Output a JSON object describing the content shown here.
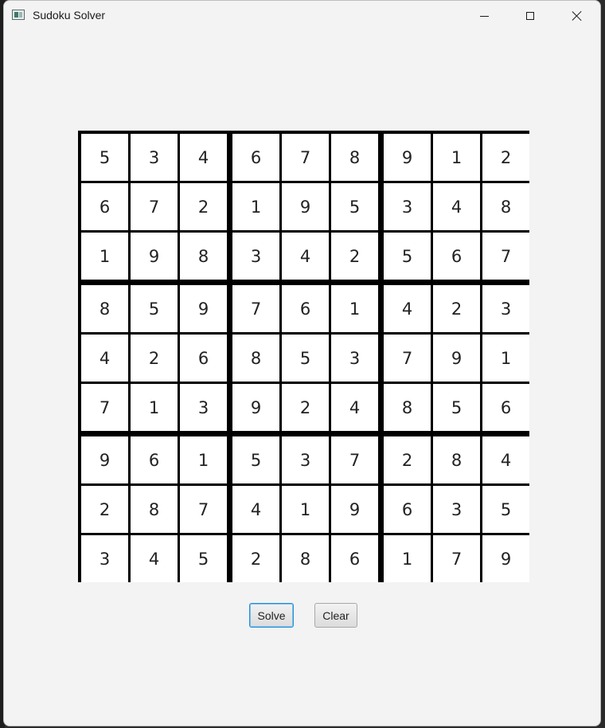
{
  "window": {
    "title": "Sudoku Solver",
    "controls": {
      "minimize": "minimize-icon",
      "maximize": "maximize-icon",
      "close": "close-icon"
    }
  },
  "board": {
    "rows": [
      [
        "5",
        "3",
        "4",
        "6",
        "7",
        "8",
        "9",
        "1",
        "2"
      ],
      [
        "6",
        "7",
        "2",
        "1",
        "9",
        "5",
        "3",
        "4",
        "8"
      ],
      [
        "1",
        "9",
        "8",
        "3",
        "4",
        "2",
        "5",
        "6",
        "7"
      ],
      [
        "8",
        "5",
        "9",
        "7",
        "6",
        "1",
        "4",
        "2",
        "3"
      ],
      [
        "4",
        "2",
        "6",
        "8",
        "5",
        "3",
        "7",
        "9",
        "1"
      ],
      [
        "7",
        "1",
        "3",
        "9",
        "2",
        "4",
        "8",
        "5",
        "6"
      ],
      [
        "9",
        "6",
        "1",
        "5",
        "3",
        "7",
        "2",
        "8",
        "4"
      ],
      [
        "2",
        "8",
        "7",
        "4",
        "1",
        "9",
        "6",
        "3",
        "5"
      ],
      [
        "3",
        "4",
        "5",
        "2",
        "8",
        "6",
        "1",
        "7",
        "9"
      ]
    ]
  },
  "actions": {
    "solve_label": "Solve",
    "clear_label": "Clear"
  },
  "colors": {
    "grid_line": "#000000",
    "cell_background": "#ffffff",
    "window_background": "#f3f3f3",
    "focus_accent": "#2a8fd6"
  }
}
